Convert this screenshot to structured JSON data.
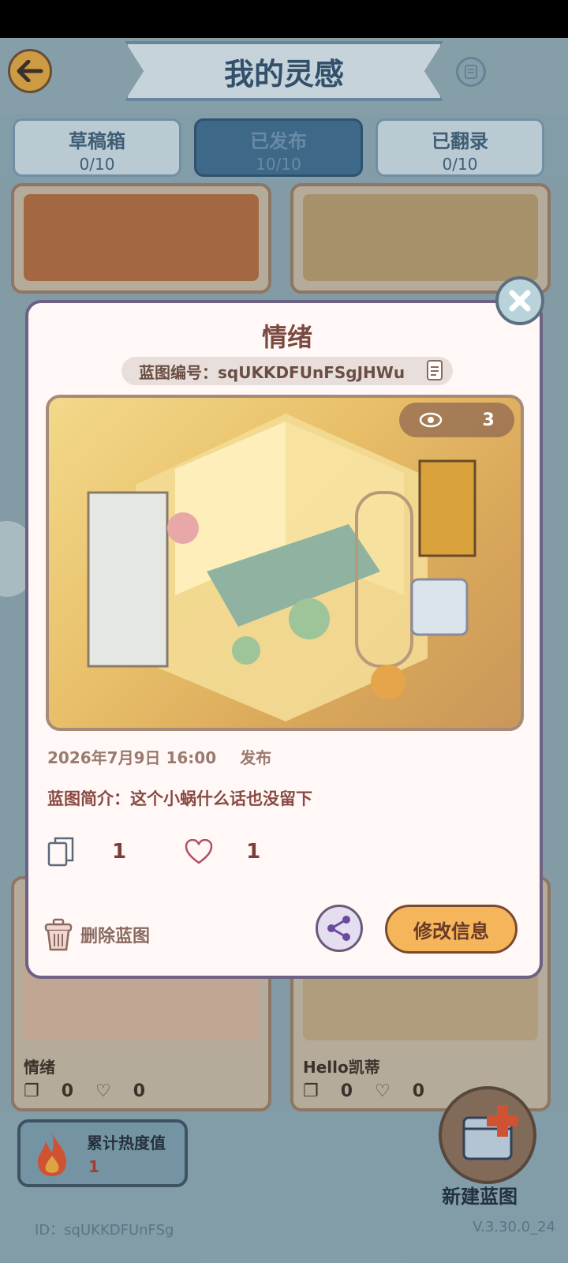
{
  "header": {
    "title": "我的灵感"
  },
  "tabs": [
    {
      "label": "草稿箱",
      "count": "0/10"
    },
    {
      "label": "已发布",
      "count": "10/10"
    },
    {
      "label": "已翻录",
      "count": "0/10"
    }
  ],
  "cards": [
    {
      "name": "情绪",
      "copies": "0",
      "likes": "0"
    },
    {
      "name": "Hello凯蒂",
      "copies": "0",
      "likes": "0"
    }
  ],
  "modal": {
    "title": "情绪",
    "blueprint_id": "蓝图编号：sqUKKDFUnFSgJHWu",
    "views": "3",
    "date": "2026年7月9日 16:00",
    "status": "发布",
    "intro": "蓝图简介：这个小蜗什么话也没留下",
    "copies": "1",
    "likes": "1",
    "delete_label": "删除蓝图",
    "edit_label": "修改信息"
  },
  "heat": {
    "label": "累计热度值",
    "value": "1"
  },
  "new_blueprint_label": "新建蓝图",
  "footer": {
    "id": "ID：sqUKKDFUnFSg",
    "version": "V.3.30.0_24"
  },
  "colors": {
    "accent": "#f5b55a",
    "primary": "#2f4d6b",
    "modal_border": "#6d6283"
  }
}
